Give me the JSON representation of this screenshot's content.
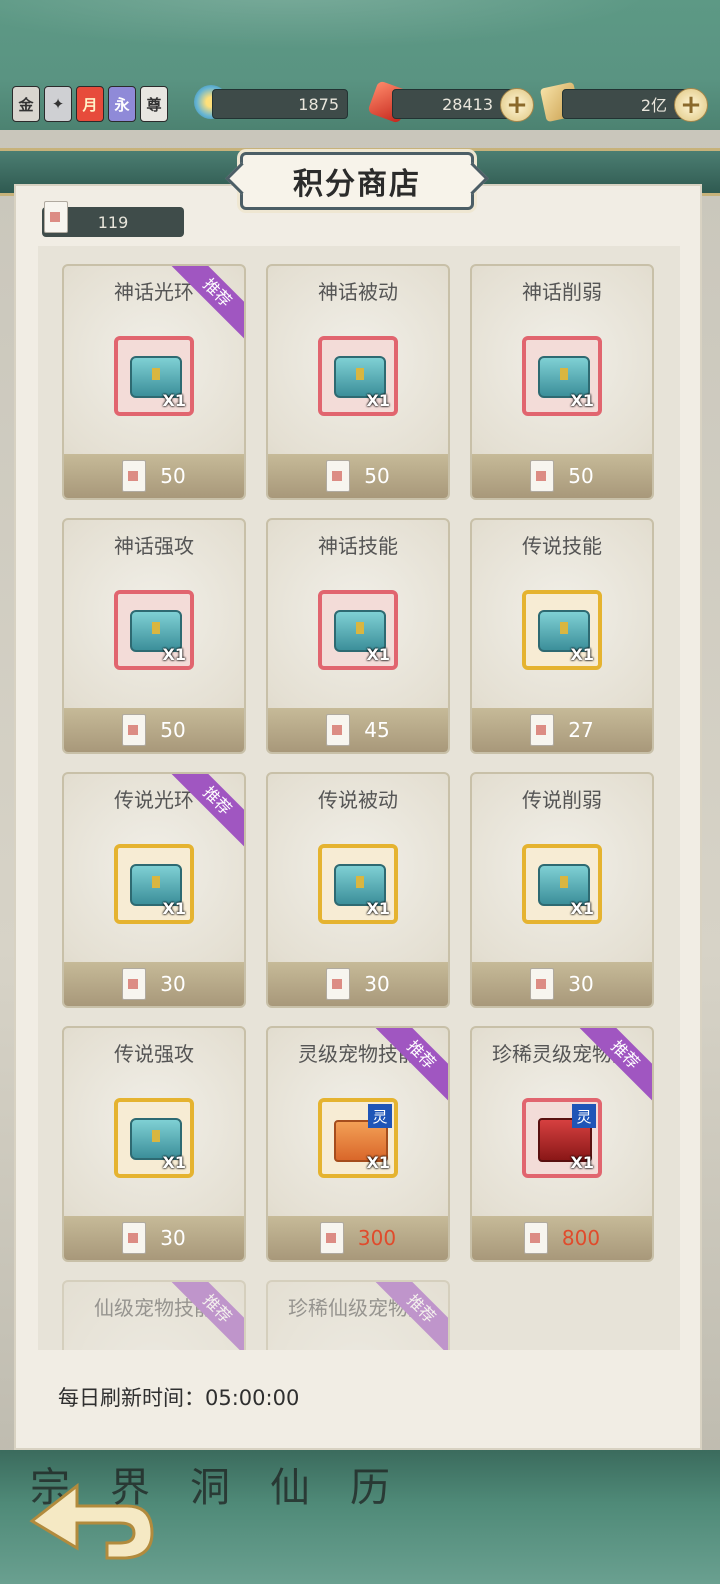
{
  "header": {
    "badges": [
      "金",
      "",
      "月",
      "永",
      "尊"
    ],
    "resources": [
      {
        "value": "1875"
      },
      {
        "value": "28413"
      },
      {
        "value": "2亿"
      }
    ]
  },
  "shop": {
    "title": "积分商店",
    "points": "119",
    "refresh_label": "每日刷新时间：05:00:00"
  },
  "items": [
    {
      "name": "神话光环",
      "price": "50",
      "rarity": "red",
      "badge": "推荐",
      "qty": "X1"
    },
    {
      "name": "神话被动",
      "price": "50",
      "rarity": "red",
      "badge": "",
      "qty": "X1"
    },
    {
      "name": "神话削弱",
      "price": "50",
      "rarity": "red",
      "badge": "",
      "qty": "X1"
    },
    {
      "name": "神话强攻",
      "price": "50",
      "rarity": "red",
      "badge": "",
      "qty": "X1"
    },
    {
      "name": "神话技能",
      "price": "45",
      "rarity": "red",
      "badge": "",
      "qty": "X1"
    },
    {
      "name": "传说技能",
      "price": "27",
      "rarity": "gold",
      "badge": "",
      "qty": "X1"
    },
    {
      "name": "传说光环",
      "price": "30",
      "rarity": "gold",
      "badge": "推荐",
      "qty": "X1"
    },
    {
      "name": "传说被动",
      "price": "30",
      "rarity": "gold",
      "badge": "",
      "qty": "X1"
    },
    {
      "name": "传说削弱",
      "price": "30",
      "rarity": "gold",
      "badge": "",
      "qty": "X1"
    },
    {
      "name": "传说强攻",
      "price": "30",
      "rarity": "gold",
      "badge": "",
      "qty": "X1"
    },
    {
      "name": "灵级宠物技能",
      "price": "300",
      "rarity": "gold",
      "badge": "推荐",
      "qty": "X1",
      "tag": "灵"
    },
    {
      "name": "珍稀灵级宠物技",
      "price": "800",
      "rarity": "red",
      "badge": "推荐",
      "qty": "X1",
      "tag": "灵"
    },
    {
      "name": "仙级宠物技能",
      "price": "",
      "rarity": "gold",
      "badge": "推荐",
      "qty": ""
    },
    {
      "name": "珍稀仙级宠物技",
      "price": "",
      "rarity": "red",
      "badge": "推荐",
      "qty": ""
    }
  ],
  "bottom_nav": [
    "宗",
    "界",
    "洞",
    "仙",
    "历"
  ]
}
